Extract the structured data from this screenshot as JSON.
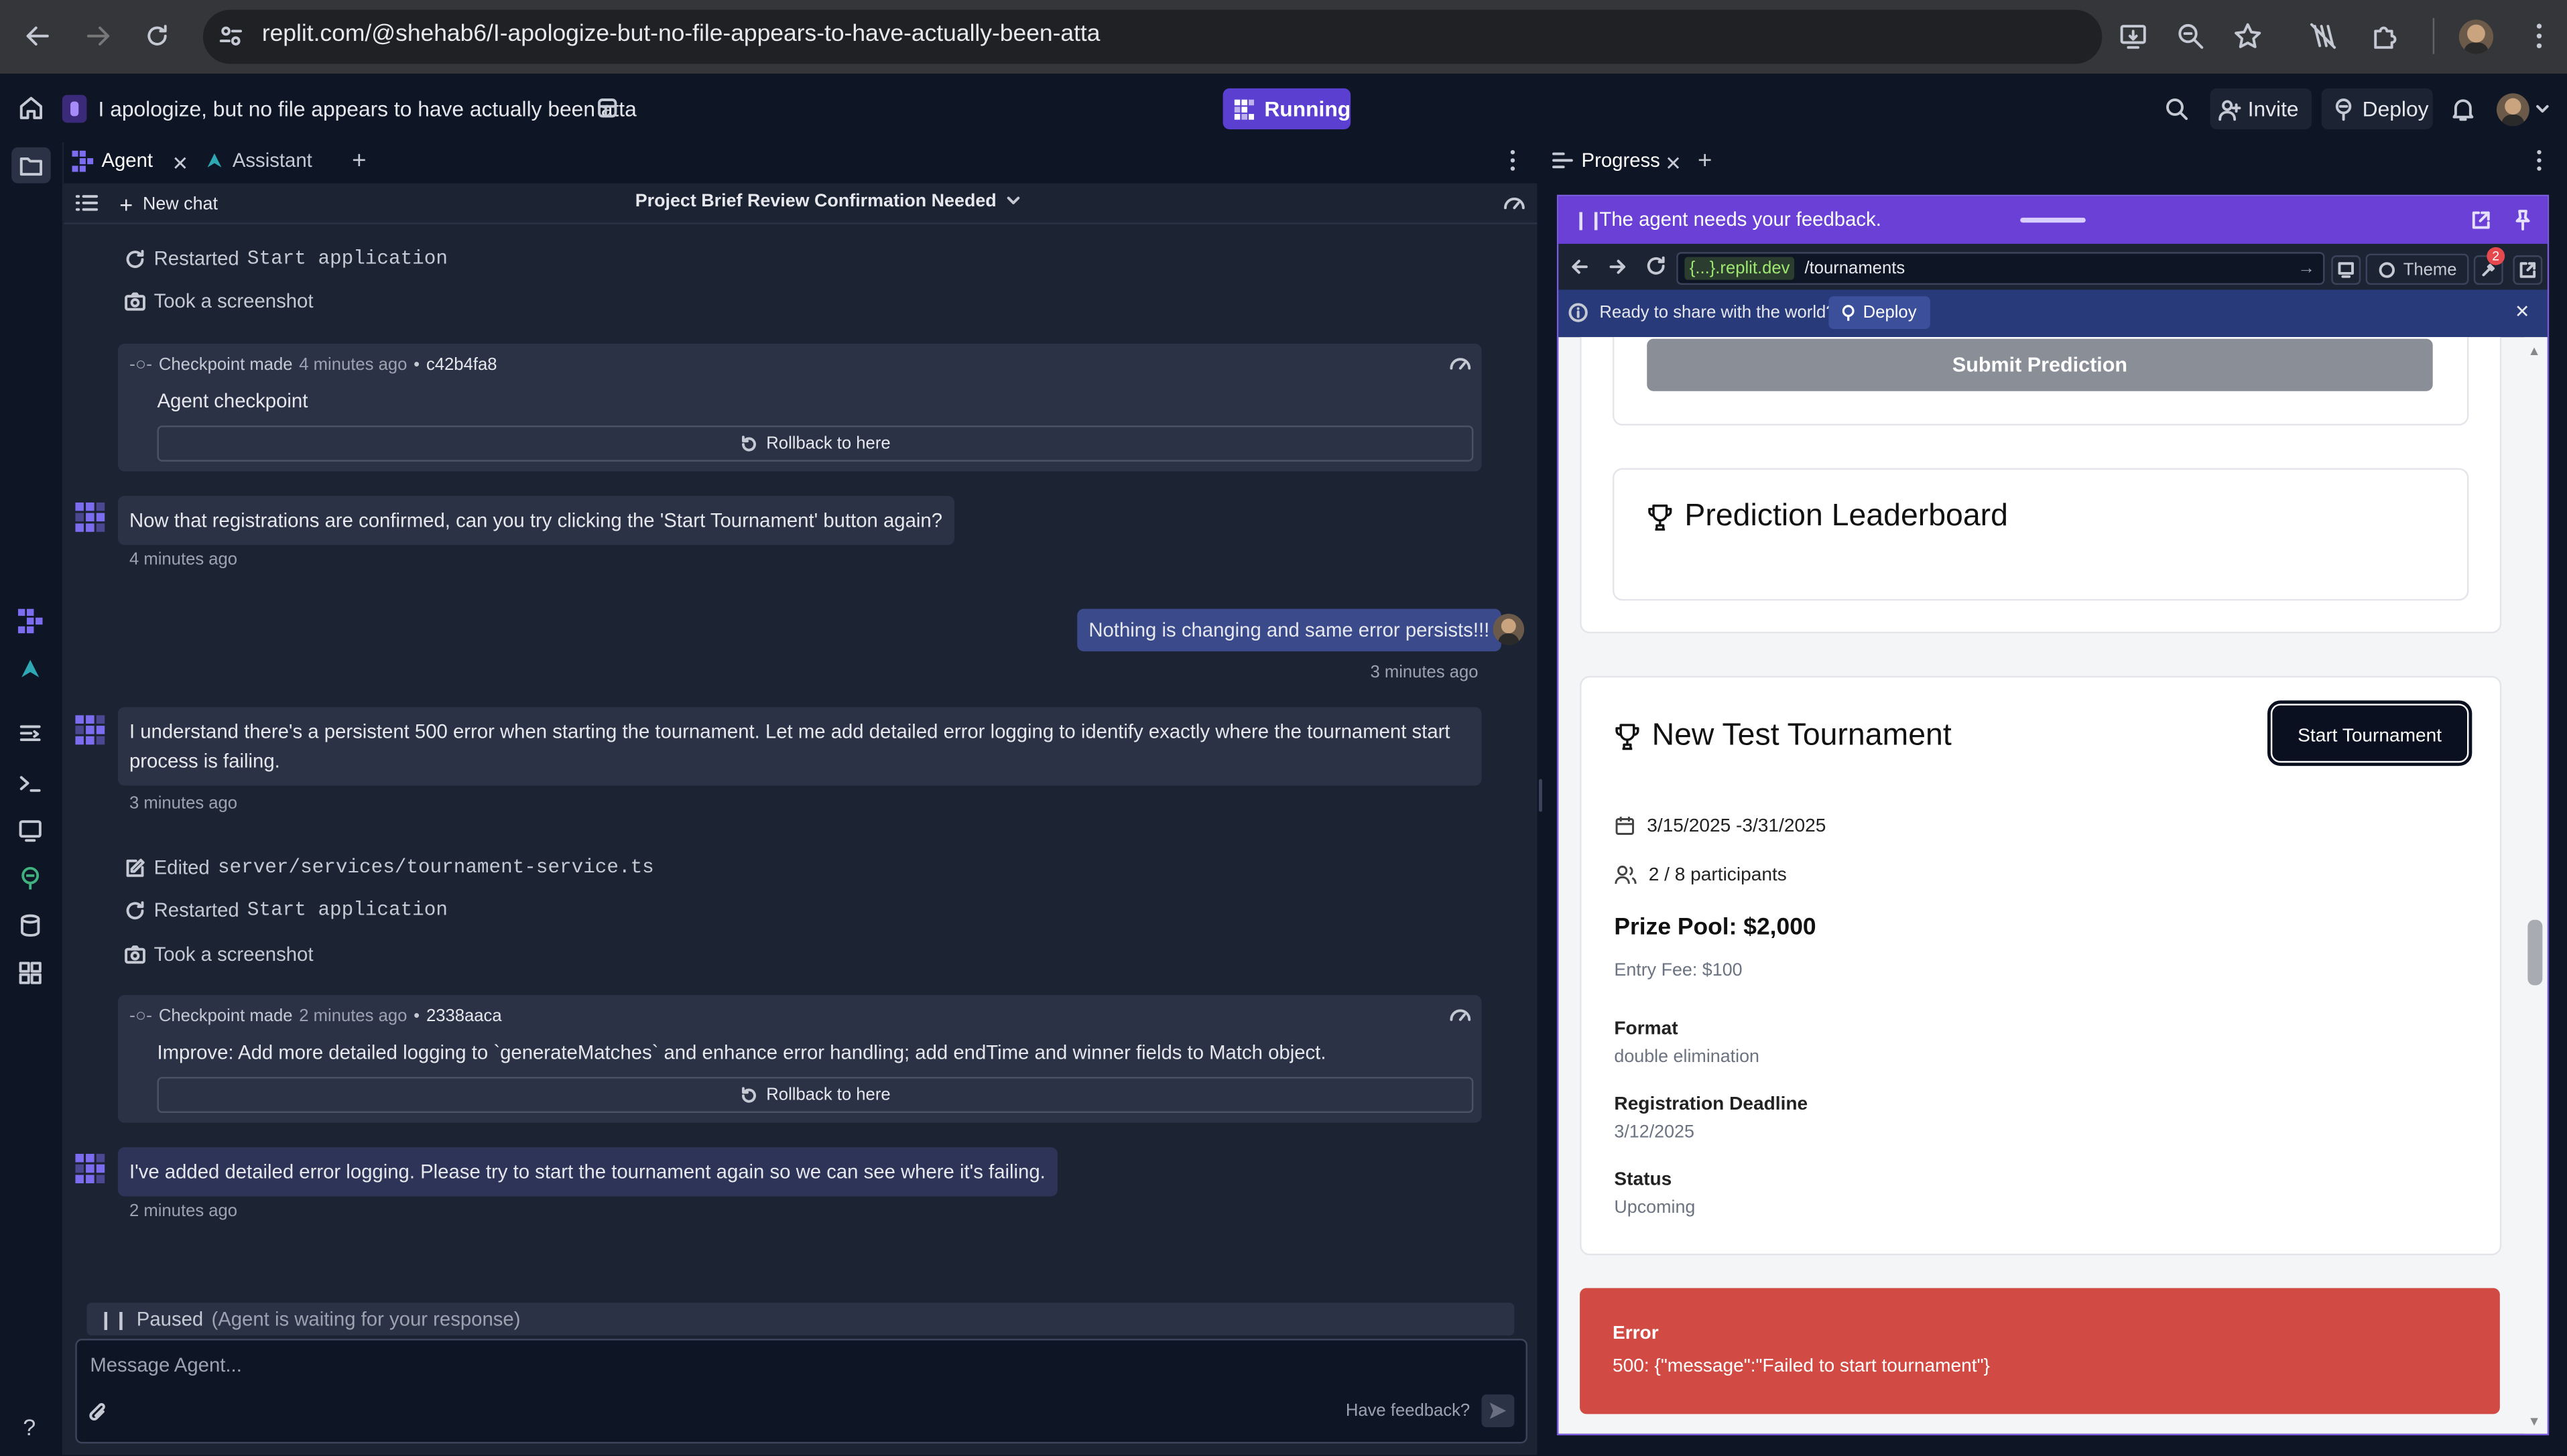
{
  "browser": {
    "url": "replit.com/@shehab6/I-apologize-but-no-file-appears-to-have-actually-been-atta"
  },
  "header": {
    "project_title": "I apologize, but no file appears to have actually been atta",
    "status": "Running",
    "invite_label": "Invite",
    "deploy_label": "Deploy"
  },
  "agent_pane": {
    "tabs": [
      "Agent",
      "Assistant"
    ],
    "new_chat_label": "New chat",
    "chat_title": "Project Brief Review Confirmation Needed",
    "activity_top": [
      {
        "verb": "Restarted",
        "target": "Start application"
      },
      {
        "verb": "Took a screenshot",
        "target": ""
      }
    ],
    "checkpoint_1": {
      "label": "Checkpoint made",
      "time": "4 minutes ago",
      "hash": "c42b4fa8",
      "message": "Agent checkpoint",
      "rollback": "Rollback to here"
    },
    "msg_1": {
      "text": "Now that registrations are confirmed, can you try clicking the 'Start Tournament' button again?",
      "time": "4 minutes ago"
    },
    "msg_user": {
      "text": "Nothing is changing and same error persists!!!",
      "time": "3 minutes ago"
    },
    "msg_2": {
      "text": "I understand there's a persistent 500 error when starting the tournament. Let me add detailed error logging to identify exactly where the tournament start process is failing.",
      "time": "3 minutes ago"
    },
    "activity_mid": [
      {
        "verb": "Edited",
        "target": "server/services/tournament-service.ts"
      },
      {
        "verb": "Restarted",
        "target": "Start application"
      },
      {
        "verb": "Took a screenshot",
        "target": ""
      }
    ],
    "checkpoint_2": {
      "label": "Checkpoint made",
      "time": "2 minutes ago",
      "hash": "2338aaca",
      "message": "Improve: Add more detailed logging to `generateMatches` and enhance error handling; add endTime and winner fields to Match object.",
      "rollback": "Rollback to here"
    },
    "msg_3": {
      "text": "I've added detailed error logging. Please try to start the tournament again so we can see where it's failing.",
      "time": "2 minutes ago"
    },
    "paused_label": "Paused",
    "paused_note": "(Agent is waiting for your response)",
    "input_placeholder": "Message Agent...",
    "feedback_label": "Have feedback?"
  },
  "progress_pane": {
    "tab": "Progress",
    "banner": "The agent needs your feedback.",
    "domain": "{...}.replit.dev",
    "path": "/tournaments",
    "theme_label": "Theme",
    "badge_count": "2",
    "share_text": "Ready to share with the world?",
    "share_deploy": "Deploy"
  },
  "app_page": {
    "submit_prediction": "Submit Prediction",
    "leaderboard_title": "Prediction Leaderboard",
    "tournament_name": "New Test Tournament",
    "start_button": "Start Tournament",
    "dates": "3/15/2025 -3/31/2025",
    "participants": "2 / 8 participants",
    "prize_pool": "Prize Pool: $2,000",
    "entry_fee": "Entry Fee: $100",
    "format_label": "Format",
    "format_value": "double elimination",
    "deadline_label": "Registration Deadline",
    "deadline_value": "3/12/2025",
    "status_label": "Status",
    "status_value": "Upcoming",
    "error_title": "Error",
    "error_message": "500: {\"message\":\"Failed to start tournament\"}"
  }
}
